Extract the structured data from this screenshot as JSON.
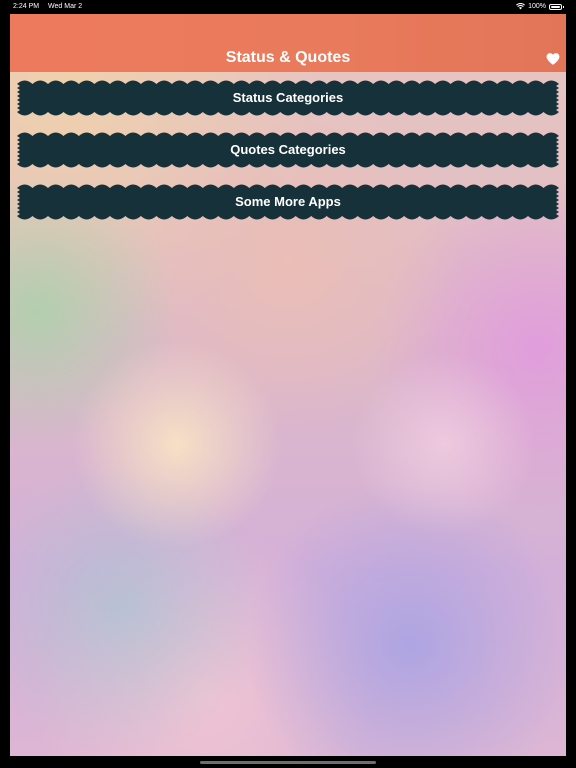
{
  "status_bar": {
    "time": "2:24 PM",
    "date": "Wed Mar 2",
    "battery_percent": "100%"
  },
  "header": {
    "title": "Status & Quotes"
  },
  "menu": {
    "items": [
      {
        "label": "Status Categories"
      },
      {
        "label": "Quotes Categories"
      },
      {
        "label": "Some More Apps"
      }
    ]
  },
  "colors": {
    "header": "#ec7a5c",
    "button": "#17313a",
    "text": "#ffffff"
  }
}
